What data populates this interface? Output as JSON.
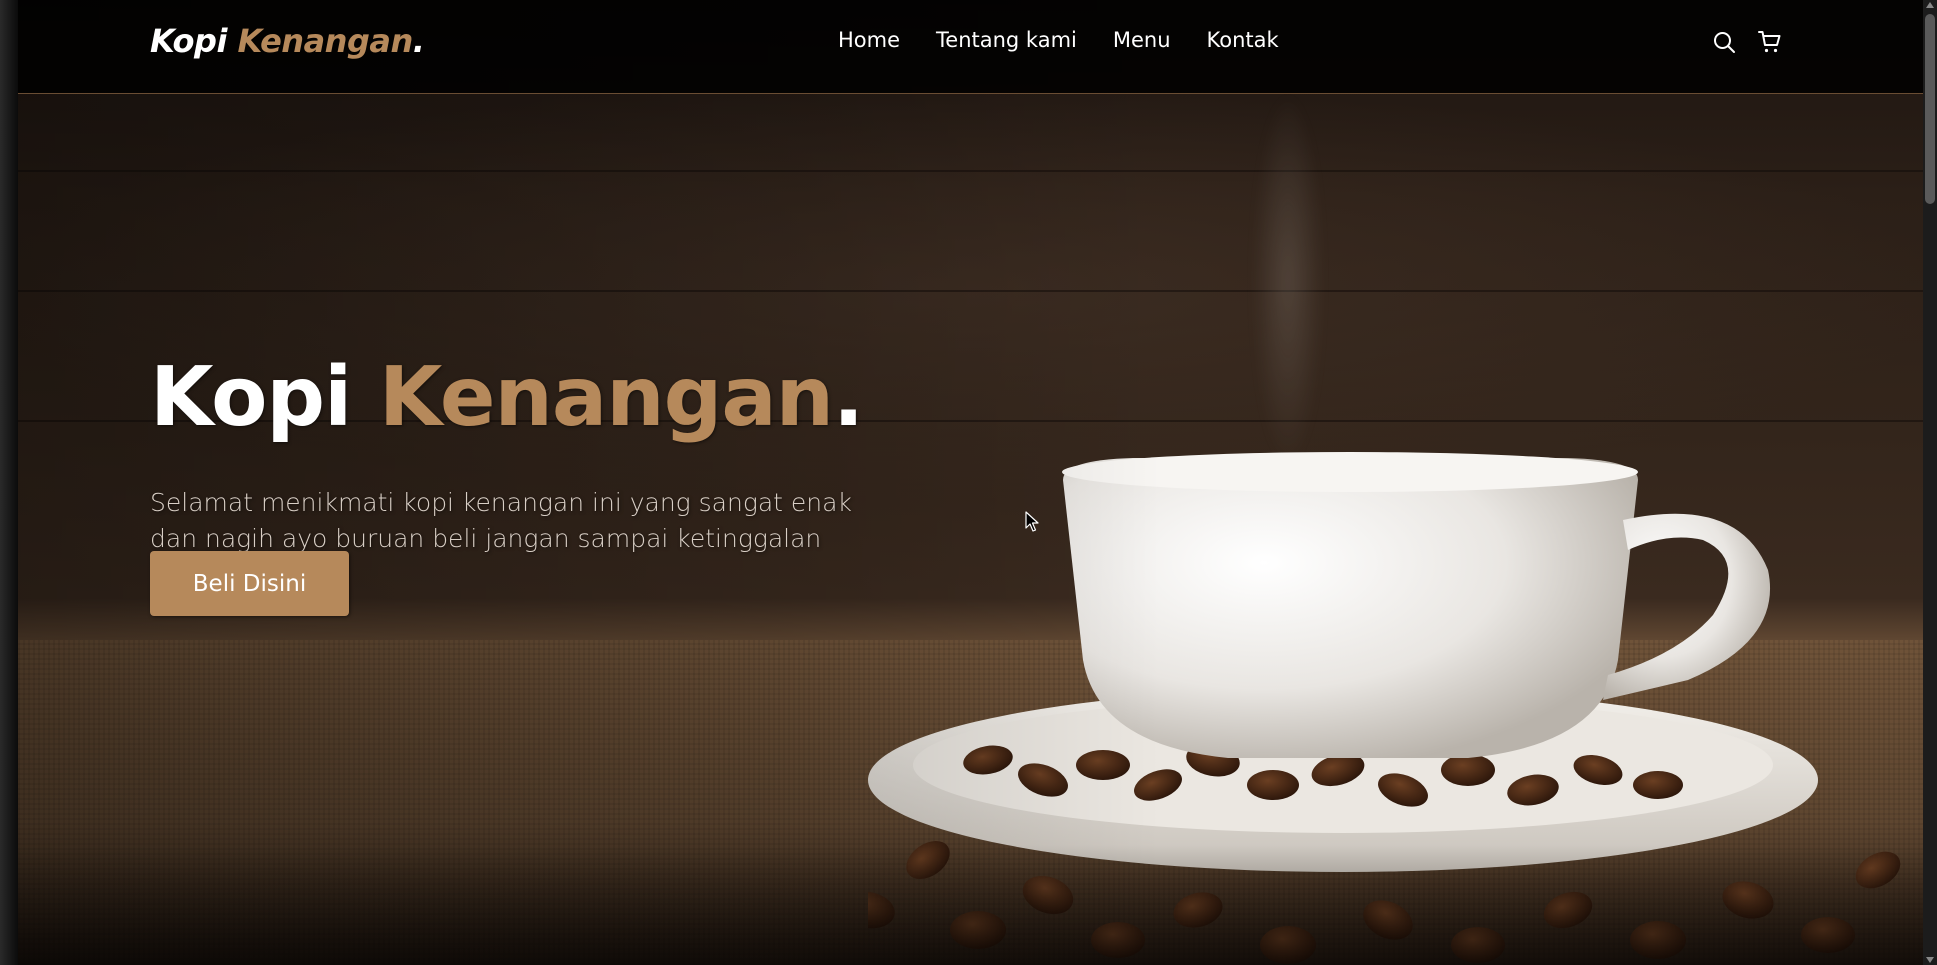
{
  "brand": {
    "name_main": "Kopi",
    "name_accent": "Kenangan",
    "dot": "."
  },
  "nav": {
    "links": [
      {
        "label": "Home"
      },
      {
        "label": "Tentang kami"
      },
      {
        "label": "Menu"
      },
      {
        "label": "Kontak"
      }
    ],
    "icons": [
      "search-icon",
      "shopping-cart-icon"
    ]
  },
  "hero": {
    "title_main": "Kopi",
    "title_accent": "Kenangan",
    "title_dot": ".",
    "description": "Selamat menikmati kopi kenangan ini yang sangat enak dan nagih ayo buruan beli jangan sampai ketinggalan",
    "cta_label": "Beli Disini",
    "image": "coffee-cup-with-beans"
  },
  "colors": {
    "accent": "#b6895b",
    "navbar_bg": "#000000",
    "text": "#ffffff"
  }
}
